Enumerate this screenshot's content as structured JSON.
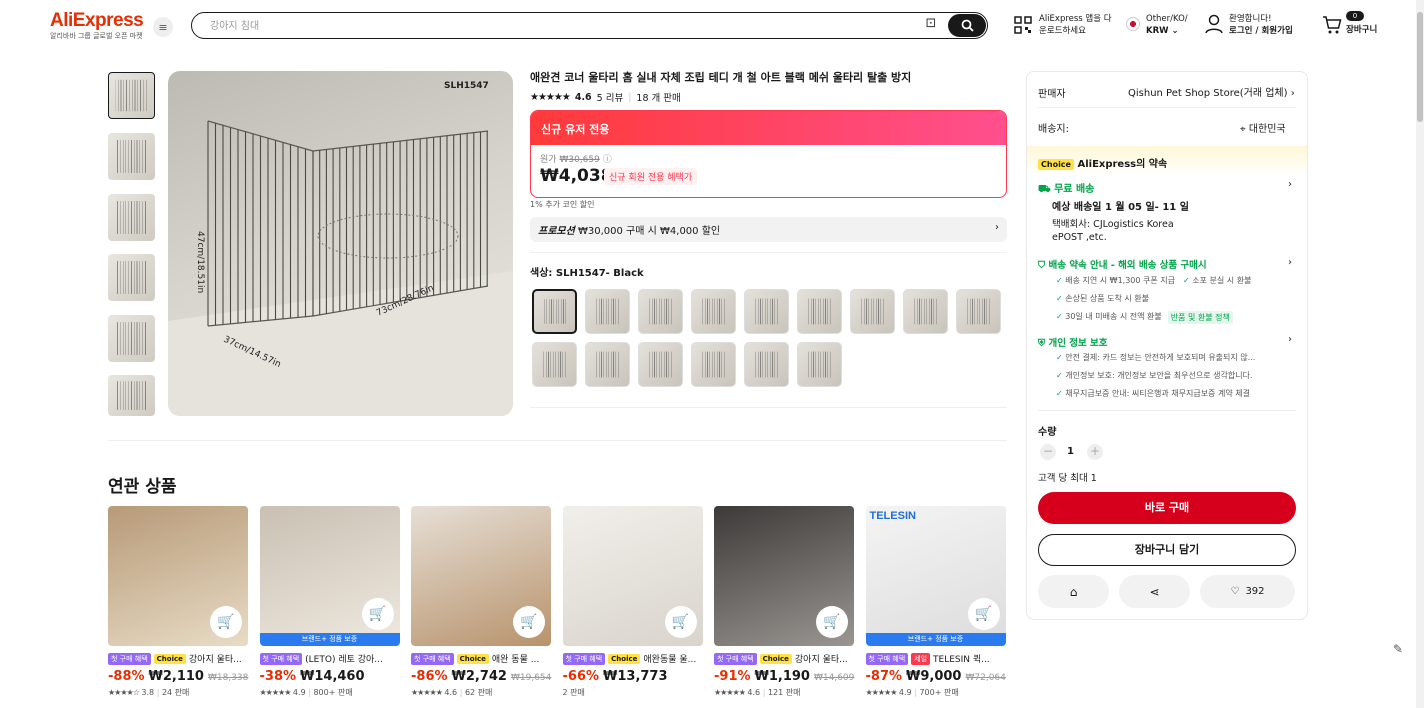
{
  "header": {
    "logo_main": "AliExpress",
    "logo_sub": "알리바바 그룹 글로벌 오픈 마켓",
    "search_placeholder": "강아지 침대",
    "app_line1": "AliExpress 앱을 다",
    "app_line2": "운로드하세요",
    "region_line1": "Other/KO/",
    "region_line2": "KRW",
    "account_line1": "환영합니다!",
    "account_line2": "로그인 / 회원가입",
    "cart_count": "0",
    "cart_label": "장바구니"
  },
  "product": {
    "title": "애완견 코너 울타리 홈 실내 자체 조립 테디 개 철 아트 블랙 메쉬 울타리 탈출 방지",
    "rating": "4.6",
    "reviews": "5 리뷰",
    "sold": "18 개 판매",
    "image_code": "SLH1547",
    "dim_height": "47cm/18.51in",
    "dim_depth": "37cm/14.57in",
    "dim_width": "73cm/28.76in",
    "promo_header": "신규 유저 전용",
    "orig_label": "원가",
    "orig_price": "₩30,659",
    "price": "₩4,038",
    "price_tag": "신규 회원 전용 혜택가",
    "coin_text": "1% 추가 코인 할인",
    "promotion_label": "프로모션",
    "promotion_text": "₩30,000 구매 시 ₩4,000 할인",
    "color_label": "색상: SLH1547- Black"
  },
  "panel": {
    "seller_label": "판매자",
    "seller_name": "Qishun Pet Shop Store(거래 업체)",
    "ship_to_label": "배송지:",
    "ship_to": "대한민국",
    "choice_tag": "Choice",
    "choice_promise": "AliExpress의 약속",
    "free_ship": "무료 배송",
    "delivery_date": "예상 배송일 1 월 05 일- 11 일",
    "carrier_line1": "택배회사:  CJLogistics  Korea",
    "carrier_line2": "ePOST ,etc.",
    "guarantee_title": "배송 약속 안내 - 해외 배송 상품 구매시",
    "guarantee_1a": "배송 지연 시 ₩1,300 쿠폰 지급",
    "guarantee_1b": "소포 분실 시 환불",
    "guarantee_2": "손상된 상품 도착 시 환불",
    "guarantee_3": "30일 내 미배송 시 전액 환불",
    "refund_policy": "반품 및 환불 정책",
    "privacy_title": "개인 정보 보호",
    "privacy_1": "안전 결제: 카드 정보는 안전하게 보호되며 유출되지 않...",
    "privacy_2": "개인정보 보호: 개인정보 보안을 최우선으로 생각합니다.",
    "privacy_3": "채무지급보증 안내: 씨티은행과 채무지급보증 계약 체결",
    "qty_label": "수량",
    "qty_value": "1",
    "qty_limit": "고객 당 최대 1",
    "buy_now": "바로 구매",
    "add_cart": "장바구니 담기",
    "wish_count": "392"
  },
  "related": {
    "title": "연관 상품",
    "items": [
      {
        "tag1": "첫 구매 혜택",
        "tag2": "Choice",
        "name": "강아지 울타...",
        "discount": "-88%",
        "price": "₩2,110",
        "old": "₩18,338",
        "stars": "★★★★☆",
        "rating": "3.8",
        "sold": "24 판매",
        "strip": ""
      },
      {
        "tag1": "첫 구매 혜택",
        "tag2": "",
        "name": "(LETO) 레토 강아...",
        "discount": "-38%",
        "price": "₩14,460",
        "old": "",
        "stars": "★★★★★",
        "rating": "4.9",
        "sold": "800+ 판매",
        "strip": "브랜드+ 정품 보증"
      },
      {
        "tag1": "첫 구매 혜택",
        "tag2": "Choice",
        "name": "애완 동물 ...",
        "discount": "-86%",
        "price": "₩2,742",
        "old": "₩19,654",
        "stars": "★★★★★",
        "rating": "4.6",
        "sold": "62 판매",
        "strip": ""
      },
      {
        "tag1": "첫 구매 혜택",
        "tag2": "Choice",
        "name": "애완동물 울...",
        "discount": "-66%",
        "price": "₩13,773",
        "old": "",
        "stars": "",
        "rating": "",
        "sold": "2 판매",
        "strip": ""
      },
      {
        "tag1": "첫 구매 혜택",
        "tag2": "Choice",
        "name": "강아지 울타...",
        "discount": "-91%",
        "price": "₩1,190",
        "old": "₩14,609",
        "stars": "★★★★★",
        "rating": "4.6",
        "sold": "121 판매",
        "strip": ""
      },
      {
        "tag1": "첫 구매 혜택",
        "tag2": "세일",
        "name": "TELESIN 퀵...",
        "discount": "-87%",
        "price": "₩9,000",
        "old": "₩72,064",
        "stars": "★★★★★",
        "rating": "4.9",
        "sold": "700+ 판매",
        "strip": "브랜드+ 정품 보증",
        "brand": "TELESIN"
      }
    ]
  },
  "colors": {
    "accent": "#e62e04",
    "buy": "#d7001c",
    "promo": "#fd384f",
    "choice": "#ffe145",
    "green": "#00a34a"
  }
}
